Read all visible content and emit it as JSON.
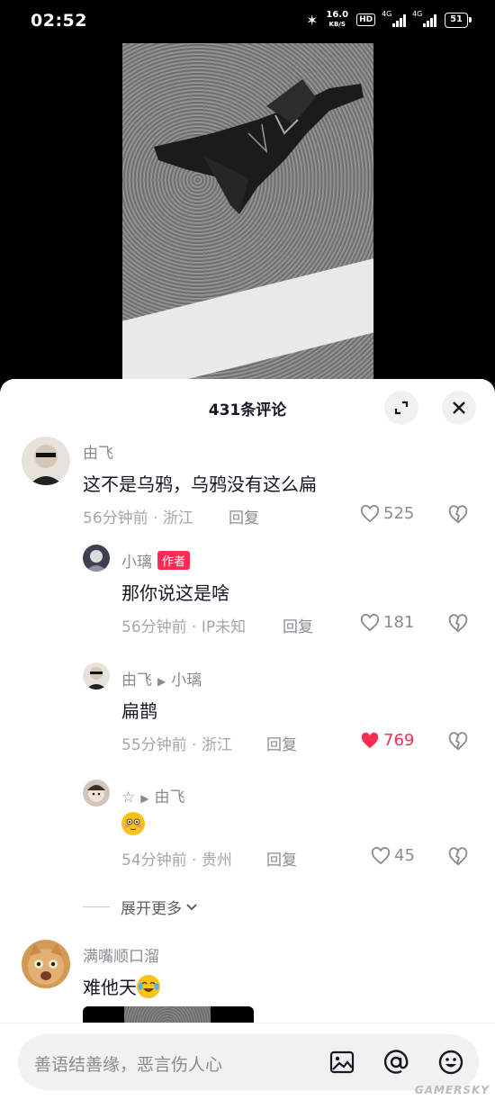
{
  "status_bar": {
    "time": "02:52",
    "net_speed_value": "16.0",
    "net_speed_unit": "KB/S",
    "hd_label": "HD",
    "signal_1_label": "4G",
    "signal_2_label": "4G",
    "battery": "51"
  },
  "comments_sheet": {
    "title": "431条评论",
    "comments": [
      {
        "username": "由飞",
        "text": "这不是乌鸦，乌鸦没有这么扁",
        "meta": "56分钟前 · 浙江",
        "reply_label": "回复",
        "likes": "525",
        "liked": false
      },
      {
        "username": "小璃",
        "author_badge": "作者",
        "text": "那你说这是啥",
        "meta": "56分钟前 · IP未知",
        "reply_label": "回复",
        "likes": "181",
        "liked": false
      },
      {
        "username": "由飞",
        "reply_to": "小璃",
        "text": "扁鹊",
        "meta": "55分钟前 · 浙江",
        "reply_label": "回复",
        "likes": "769",
        "liked": true
      },
      {
        "username": "☆",
        "reply_to": "由飞",
        "text": "",
        "emoji": "flushed-face",
        "meta": "54分钟前 · 贵州",
        "reply_label": "回复",
        "likes": "45",
        "liked": false
      },
      {
        "username": "满嘴顺口溜",
        "text": "难他天",
        "emoji": "laughing-crying-face"
      }
    ],
    "expand_more_label": "展开更多"
  },
  "input_bar": {
    "placeholder": "善语结善缘，恶言伤人心"
  },
  "watermark": "GAMERSKY",
  "colors": {
    "accent": "#fe2c55",
    "text_primary": "#161823",
    "text_secondary": "#8a8b91"
  }
}
